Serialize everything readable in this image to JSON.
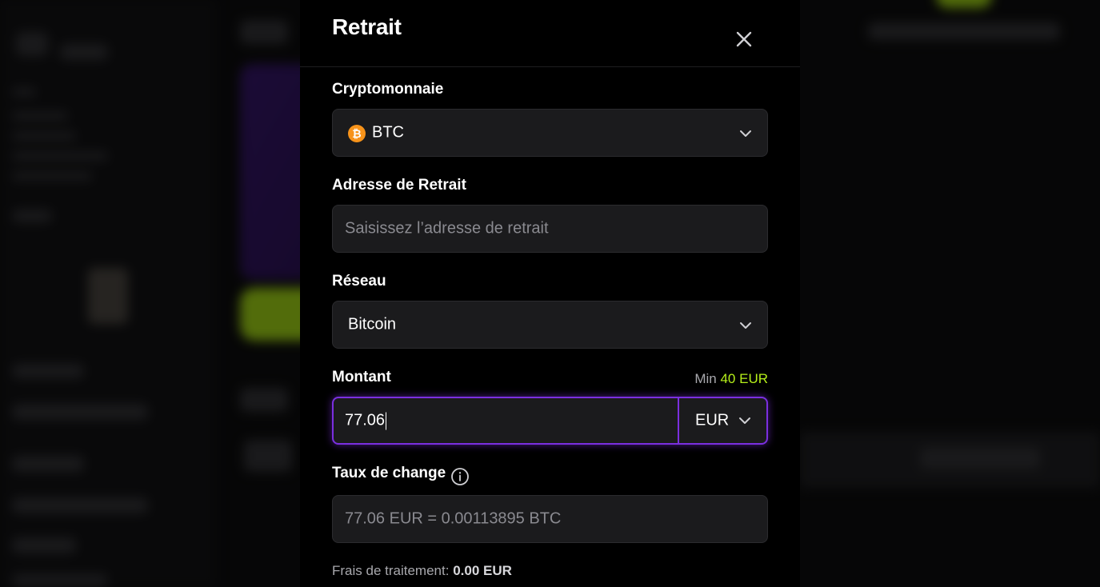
{
  "modal": {
    "title": "Retrait",
    "crypto": {
      "label": "Cryptomonnaie",
      "selected": "BTC",
      "icon": "bitcoin-icon",
      "icon_glyph": "₿",
      "icon_color": "#f7931a"
    },
    "address": {
      "label": "Adresse de Retrait",
      "placeholder": "Saisissez l’adresse de retrait",
      "value": ""
    },
    "network": {
      "label": "Réseau",
      "selected": "Bitcoin"
    },
    "amount": {
      "label": "Montant",
      "min_prefix": "Min",
      "min_value": "40 EUR",
      "value": "77.06",
      "currency": "EUR"
    },
    "exchange": {
      "label": "Taux de change",
      "value": "77.06 EUR = 0.00113895 BTC"
    },
    "fee": {
      "label": "Frais de traitement:",
      "value": "0.00 EUR"
    }
  },
  "colors": {
    "accent_purple": "#7b2fe0",
    "accent_green": "#b6f01a",
    "btc_orange": "#f7931a",
    "modal_bg": "#000000",
    "field_bg": "#1b1b1d"
  }
}
